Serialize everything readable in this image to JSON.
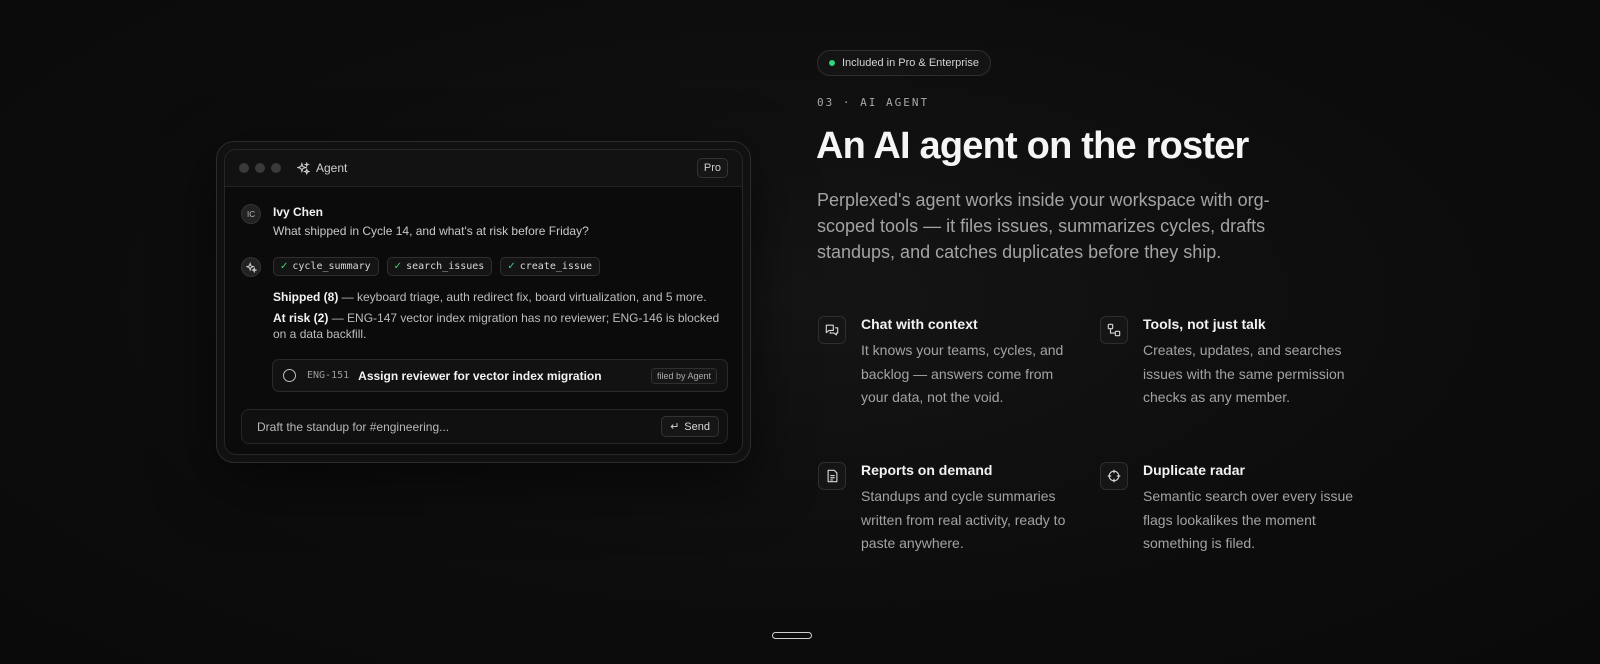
{
  "agent_window": {
    "title": "Agent",
    "badge": "Pro",
    "user": {
      "initials": "IC",
      "name": "Ivy Chen",
      "message": "What shipped in Cycle 14, and what's at risk before Friday?"
    },
    "tool_calls": [
      "cycle_summary",
      "search_issues",
      "create_issue"
    ],
    "response": {
      "shipped_label": "Shipped (8)",
      "shipped_text": " — keyboard triage, auth redirect fix, board virtualization, and 5 more.",
      "risk_label": "At risk (2)",
      "risk_text": " — ENG-147 vector index migration has no reviewer; ENG-146 is blocked on a data backfill."
    },
    "issue": {
      "id": "ENG-151",
      "title": "Assign reviewer for vector index migration",
      "tag": "filed by Agent"
    },
    "composer": {
      "placeholder": "Draft the standup for #engineering...",
      "send_label": "Send"
    }
  },
  "section": {
    "pill": "Included in Pro & Enterprise",
    "eyebrow": "03 · AI AGENT",
    "headline": "An AI agent on the roster",
    "lede": "Perplexed's agent works inside your workspace with org-scoped tools — it files issues, summarizes cycles, drafts standups, and catches duplicates before they ship.",
    "features": [
      {
        "icon": "chat-icon",
        "title": "Chat with context",
        "desc": "It knows your teams, cycles, and backlog — answers come from your data, not the void."
      },
      {
        "icon": "tools-icon",
        "title": "Tools, not just talk",
        "desc": "Creates, updates, and searches issues with the same permission checks as any member."
      },
      {
        "icon": "document-icon",
        "title": "Reports on demand",
        "desc": "Standups and cycle summaries written from real activity, ready to paste anywhere."
      },
      {
        "icon": "crosshair-icon",
        "title": "Duplicate radar",
        "desc": "Semantic search over every issue flags lookalikes the moment something is filed."
      }
    ]
  },
  "colors": {
    "accent_green": "#2fd37a",
    "background": "#0d0d0d"
  }
}
